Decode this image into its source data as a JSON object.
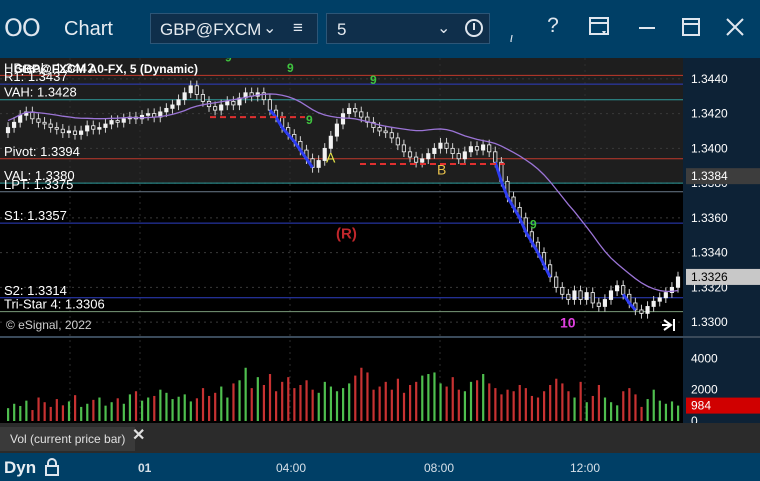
{
  "window": {
    "title": "Chart",
    "symbol": "GBP@FXCM",
    "interval": "5"
  },
  "icons": {
    "window_icon": "chart-window-icon",
    "symbol_dropdown": "chevron-down-icon",
    "symbol_list": "list-icon",
    "interval_dropdown": "chevron-down-icon",
    "interval_clock": "clock-icon",
    "help": "question-icon",
    "layout": "layout-icon",
    "minimize": "minimize-icon",
    "maximize": "maximize-icon",
    "close": "close-icon",
    "go_to_end": "go-to-end-icon",
    "lock": "lock-icon"
  },
  "chart_data": {
    "type": "candlestick",
    "symbol_line": "GBP@FXCM A0-FX, 5 (Dynamic)",
    "copyright": "© eSignal, 2022",
    "price_axis": {
      "ylim": [
        1.3292,
        1.3452
      ],
      "ticks": [
        "1.3440",
        "1.3420",
        "1.3400",
        "1.3380",
        "1.3360",
        "1.3340",
        "1.3320",
        "1.3300"
      ],
      "last_price_labels": [
        "1.3384",
        "1.3326"
      ]
    },
    "levels": [
      {
        "label": "HBreak: 1.3442",
        "value": 1.3442,
        "color": "#c0392b"
      },
      {
        "label": "R1: 1.3437",
        "value": 1.3437,
        "color": "#2e3fc4"
      },
      {
        "label": "VAH: 1.3428",
        "value": 1.3428,
        "color": "#2e9c9c"
      },
      {
        "label": "Pivot: 1.3394",
        "value": 1.3394,
        "color": "#c0392b"
      },
      {
        "label": "VAL: 1.3380",
        "value": 1.338,
        "color": "#2e9c9c"
      },
      {
        "label": "LPT: 1.3375",
        "value": 1.3375,
        "color": "#6a7a8a"
      },
      {
        "label": "S1: 1.3357",
        "value": 1.3357,
        "color": "#2e3fc4"
      },
      {
        "label": "S2: 1.3314",
        "value": 1.3314,
        "color": "#2e3fc4"
      },
      {
        "label": "Tri-Star 4: 1.3306",
        "value": 1.3306,
        "color": "#7a9a7a"
      }
    ],
    "annotations": [
      {
        "text": "A",
        "color": "#e8e84a"
      },
      {
        "text": "B",
        "color": "#e8c04a"
      },
      {
        "text": "(R)",
        "color": "#c0262b"
      },
      {
        "text": "10",
        "color": "#e040e0"
      },
      {
        "text": "9",
        "color": "#3fc43f"
      }
    ],
    "closes": [
      1.3412,
      1.3415,
      1.3419,
      1.3421,
      1.3417,
      1.3415,
      1.3414,
      1.3412,
      1.3411,
      1.3409,
      1.341,
      1.3408,
      1.341,
      1.3413,
      1.3411,
      1.3412,
      1.3414,
      1.3416,
      1.3415,
      1.3417,
      1.3418,
      1.3417,
      1.3419,
      1.342,
      1.3418,
      1.3421,
      1.3423,
      1.3425,
      1.3428,
      1.3432,
      1.3436,
      1.3431,
      1.3427,
      1.3424,
      1.3422,
      1.3425,
      1.3427,
      1.3425,
      1.3429,
      1.3432,
      1.343,
      1.3432,
      1.3428,
      1.3422,
      1.3418,
      1.3412,
      1.3408,
      1.3404,
      1.3399,
      1.3394,
      1.3389,
      1.3393,
      1.34,
      1.3407,
      1.3414,
      1.342,
      1.3423,
      1.3421,
      1.3418,
      1.3415,
      1.3412,
      1.341,
      1.3409,
      1.3406,
      1.3402,
      1.3398,
      1.3395,
      1.3392,
      1.3394,
      1.3397,
      1.34,
      1.3403,
      1.34,
      1.3397,
      1.3394,
      1.3398,
      1.3401,
      1.3399,
      1.3402,
      1.3398,
      1.3392,
      1.3381,
      1.3372,
      1.3366,
      1.336,
      1.3352,
      1.3346,
      1.334,
      1.3333,
      1.3326,
      1.332,
      1.3316,
      1.3313,
      1.3318,
      1.3313,
      1.3317,
      1.3311,
      1.3309,
      1.3313,
      1.3318,
      1.3321,
      1.3316,
      1.3311,
      1.3307,
      1.3305,
      1.3309,
      1.3312,
      1.3314,
      1.3317,
      1.332,
      1.3326
    ],
    "volume_axis": {
      "ylim": [
        0,
        5300
      ],
      "ticks": [
        "4000",
        "2000",
        "0"
      ],
      "last_volume_label": "984"
    },
    "volumes": [
      820,
      1100,
      960,
      1300,
      700,
      1500,
      1200,
      900,
      1400,
      1000,
      1250,
      1650,
      900,
      1100,
      1350,
      1500,
      980,
      1200,
      1450,
      1100,
      1700,
      1900,
      1300,
      1500,
      1600,
      2000,
      1800,
      1400,
      1550,
      1700,
      1250,
      1450,
      2100,
      1600,
      1800,
      2200,
      1500,
      2400,
      2600,
      3400,
      2100,
      2800,
      2300,
      3000,
      1900,
      2500,
      2800,
      2100,
      2300,
      2600,
      2000,
      1800,
      2500,
      2200,
      1900,
      2100,
      2400,
      2900,
      3400,
      3100,
      2000,
      2200,
      2500,
      2000,
      2700,
      1800,
      2300,
      2500,
      2900,
      3000,
      3100,
      2400,
      2200,
      2800,
      2000,
      1900,
      2500,
      2600,
      3000,
      2400,
      2100,
      1700,
      2000,
      1900,
      2300,
      2100,
      1600,
      1500,
      1900,
      2300,
      2700,
      2400,
      1900,
      1500,
      2500,
      1200,
      1600,
      2300,
      1500,
      1200,
      1000,
      1900,
      2100,
      1700,
      900,
      1400,
      2000,
      1300,
      1100,
      1250,
      984
    ],
    "indicator_label": "Vol (current price bar)",
    "time_axis": [
      "01",
      "04:00",
      "08:00",
      "12:00"
    ]
  },
  "bottom_bar": {
    "mode": "Dyn"
  }
}
